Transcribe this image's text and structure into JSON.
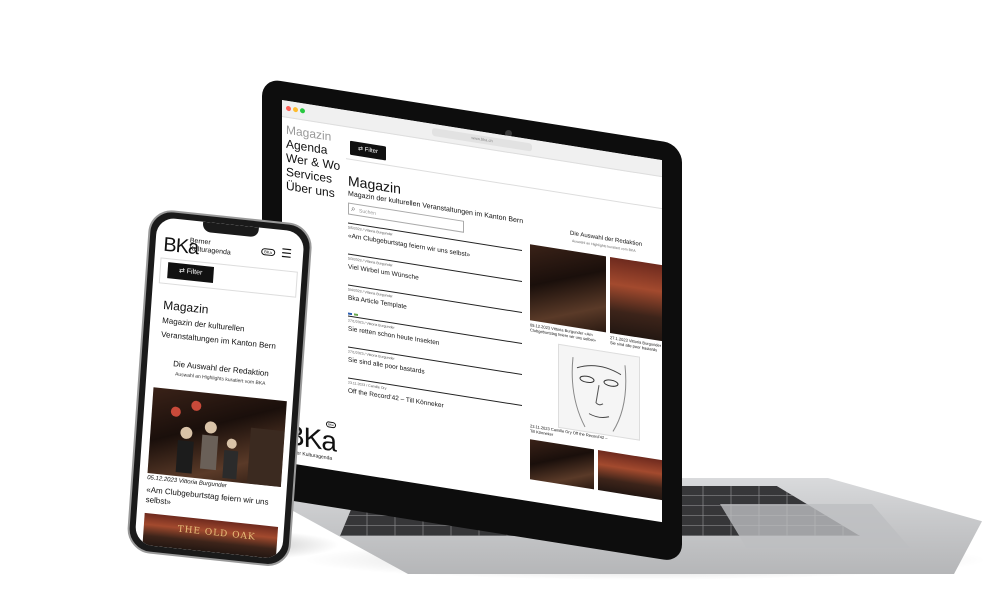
{
  "laptop": {
    "nav": [
      "Magazin",
      "Agenda",
      "Wer & Wo",
      "Services",
      "Über uns"
    ],
    "filter_label": "Filter",
    "url": "www.bka.ch",
    "title": "Magazin",
    "subtitle": "Magazin der kulturellen Veranstaltungen im Kanton Bern",
    "search_placeholder": "Suchen",
    "articles": [
      {
        "meta": "5/5/2023 / Vittoria Burgunder",
        "headline": "«Am Clubgeburtstag feiern wir uns selbst»"
      },
      {
        "meta": "5/3/2023 / Vittoria Burgunder",
        "headline": "Viel Wirbel um Wünsche"
      },
      {
        "meta": "5/4/2023 / Vittoria Burgunder",
        "headline": "Bka Article Template"
      },
      {
        "meta": "27/1/2023 / Vittoria Burgunder",
        "headline": "Sie retten schon heute Insekten"
      },
      {
        "meta": "27/1/2023 / Vittoria Burgunder",
        "headline": "Sie sind alle poor bastards"
      },
      {
        "meta": "23.11.2023 / Camille Ory",
        "headline": "Off the Record’42 – Till Könneker"
      }
    ],
    "aside_title": "Die Auswahl der Redaktion",
    "aside_sub": "Auswahl an Highlights kuratiert vom BKA",
    "aside_captions": [
      "05.12.2023 Vittoria Burgunder «Am Clubgeburtstag feiern wir uns selbst»",
      "27.1.2023 Vittoria Burgunder Sie sind alle poor bastards",
      "23.11.2023 Camille Ory Off the Record’42 – Till Könneker"
    ],
    "logo": "BKa",
    "logo_sub": "Berner Kulturagenda",
    "badge": "BKa"
  },
  "phone": {
    "logo": "BKa",
    "logo_sub_line1": "Berner",
    "logo_sub_line2": "Kulturagenda",
    "badge": "BKa",
    "menu_icon": "☰",
    "filter_label": "Filter",
    "title": "Magazin",
    "subtitle": "Magazin der kulturellen Veranstaltungen im Kanton Bern",
    "aside_title": "Die Auswahl der Redaktion",
    "aside_sub": "Auswahl an Highlights kuratiert vom BKA",
    "article_meta": "05.12.2023 Vittoria Burgunder",
    "article_headline": "«Am Clubgeburtstag feiern wir uns selbst»",
    "sign_text": "THE OLD OAK"
  },
  "colors": {
    "accent": "#111111",
    "background": "#ffffff"
  }
}
